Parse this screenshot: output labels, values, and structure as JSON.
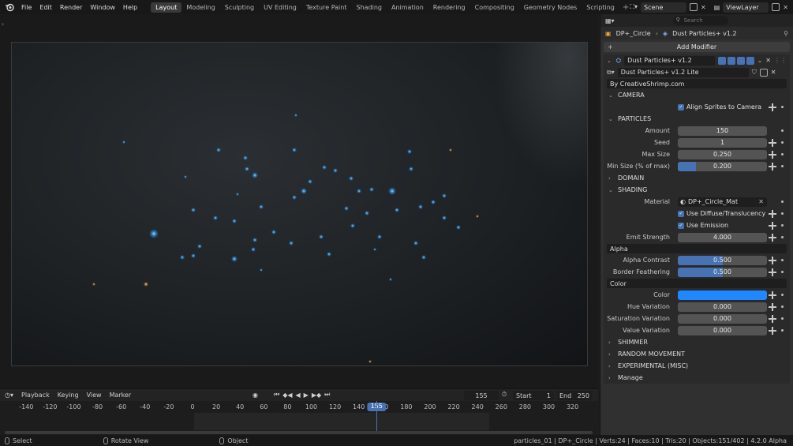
{
  "topbar": {
    "menus": [
      "File",
      "Edit",
      "Render",
      "Window",
      "Help"
    ],
    "workspaces": [
      "Layout",
      "Modeling",
      "Sculpting",
      "UV Editing",
      "Texture Paint",
      "Shading",
      "Animation",
      "Rendering",
      "Compositing",
      "Geometry Nodes",
      "Scripting"
    ],
    "active_workspace": "Layout",
    "scene": "Scene",
    "view_layer": "ViewLayer"
  },
  "outliner": {
    "search_placeholder": "Search"
  },
  "properties": {
    "breadcrumb_object": "DP+_Circle",
    "breadcrumb_modifier": "Dust Particles+ v1.2",
    "add_modifier": "Add Modifier",
    "modifier_name": "Dust Particles+ v1.2",
    "node_group": "Dust Particles+ v1.2 Lite",
    "credit": "By CreativeShrimp.com",
    "sections": {
      "camera": "CAMERA",
      "particles": "PARTICLES",
      "domain": "DOMAIN",
      "shading": "SHADING",
      "shimmer": "SHIMMER",
      "random_movement": "RANDOM MOVEMENT",
      "experimental": "EXPERIMENTAL (MISC)",
      "manage": "Manage"
    },
    "align_sprites": "Align Sprites to Camera",
    "amount_label": "Amount",
    "amount": "150",
    "seed_label": "Seed",
    "seed": "1",
    "max_size_label": "Max Size",
    "max_size": "0.250",
    "min_size_label": "Min Size (% of max)",
    "min_size": "0.200",
    "min_size_fill": 0.2,
    "material_label": "Material",
    "material": "DP+_Circle_Mat",
    "use_diffuse": "Use Diffuse/Translucency",
    "use_emission": "Use Emission",
    "emit_strength_label": "Emit Strength",
    "emit_strength": "4.000",
    "alpha_header": "Alpha",
    "alpha_contrast_label": "Alpha Contrast",
    "alpha_contrast": "0.500",
    "alpha_contrast_fill": 0.5,
    "border_feathering_label": "Border Feathering",
    "border_feathering": "0.500",
    "border_feathering_fill": 0.5,
    "color_header": "Color",
    "color_label": "Color",
    "color_value": "#1f87ff",
    "hue_label": "Hue Variation",
    "hue": "0.000",
    "saturation_label": "Saturation Variation",
    "saturation": "0.000",
    "value_label": "Value Variation",
    "value": "0.000"
  },
  "timeline": {
    "menus": [
      "Playback",
      "Keying",
      "View",
      "Marker"
    ],
    "current_frame": "155",
    "start_label": "Start",
    "start": "1",
    "end_label": "End",
    "end": "250",
    "ticks": [
      "-140",
      "-120",
      "-100",
      "-80",
      "-60",
      "-40",
      "-20",
      "0",
      "20",
      "40",
      "60",
      "80",
      "100",
      "120",
      "140",
      "160",
      "180",
      "200",
      "220",
      "240",
      "260",
      "280",
      "300",
      "320"
    ]
  },
  "statusbar": {
    "select": "Select",
    "rotate_view": "Rotate View",
    "object": "Object",
    "info": "particles_01 | DP+_Circle | Verts:24 | Faces:10 | Tris:20 | Objects:151/402 | 4.2.0 Alpha"
  }
}
